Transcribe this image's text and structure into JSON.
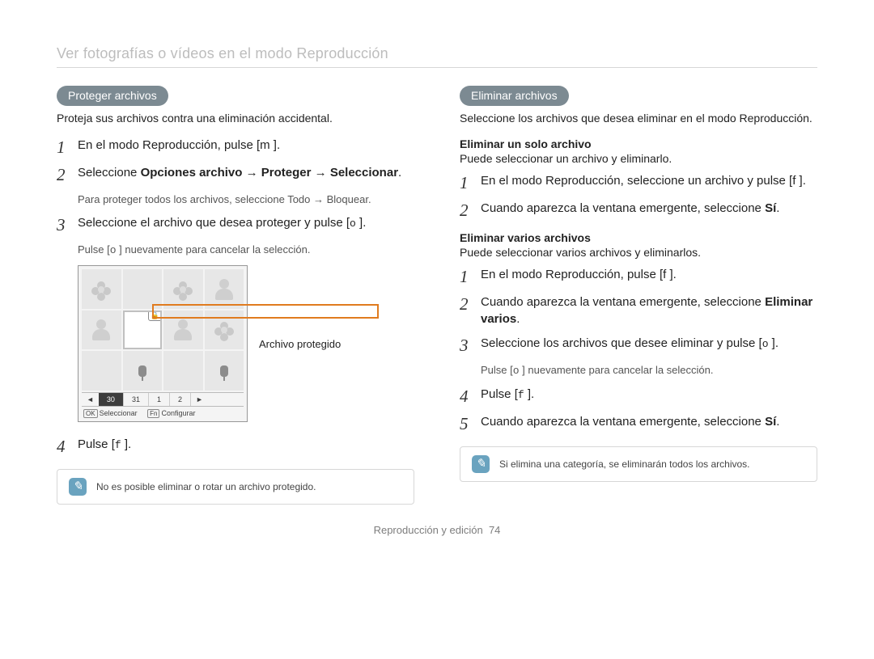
{
  "page_header": "Ver fotografías o vídeos en el modo Reproducción",
  "left": {
    "pill": "Proteger archivos",
    "intro": "Proteja sus archivos contra una eliminación accidental.",
    "step1": "En el modo Reproducción, pulse [m       ].",
    "step2_pre": "Seleccione ",
    "step2_b1": "Opciones archivo",
    "step2_arrow": " → ",
    "step2_b2": "Proteger",
    "step2_b3": "Seleccionar",
    "step2_post": ".",
    "step2_sub_pre": "Para proteger todos los archivos, seleccione ",
    "step2_sub_b1": "Todo",
    "step2_sub_b2": "Bloquear",
    "step3_pre": "Seleccione el archivo que desea proteger y pulse [",
    "step3_key": "o",
    "step3_post": "   ].",
    "step3_sub_pre": "Pulse [",
    "step3_sub_key": "o",
    "step3_sub_post": "    ] nuevamente para cancelar la selección.",
    "callout": "Archivo protegido",
    "step4_pre": "Pulse [",
    "step4_key": "f",
    "step4_post": "   ].",
    "note": "No es posible eliminar o rotar un archivo protegido."
  },
  "screen": {
    "lock_glyph": "🔒",
    "tabs": [
      "30",
      "31",
      "1",
      "2"
    ],
    "caret_l": "◄",
    "caret_r": "►",
    "btn_ok": "OK",
    "btn_ok_label": "Seleccionar",
    "btn_fn": "Fn",
    "btn_fn_label": "Configurar"
  },
  "right": {
    "pill": "Eliminar archivos",
    "intro": "Seleccione los archivos que desea eliminar en el modo Reproducción.",
    "sub1_head": "Eliminar un solo archivo",
    "sub1_text": "Puede seleccionar un archivo y eliminarlo.",
    "s1_step1": "En el modo Reproducción, seleccione un archivo y pulse [f    ].",
    "s1_step2_pre": "Cuando aparezca la ventana emergente, seleccione ",
    "s1_step2_b": "Sí",
    "sub2_head": "Eliminar varios archivos",
    "sub2_text": "Puede seleccionar varios archivos y eliminarlos.",
    "s2_step1": "En el modo Reproducción, pulse [f    ].",
    "s2_step2_pre": "Cuando aparezca la ventana emergente, seleccione ",
    "s2_step2_b": "Eliminar varios",
    "s2_step3_pre": "Seleccione los archivos que desee eliminar y pulse [",
    "s2_step3_key": "o",
    "s2_step3_post": "    ].",
    "s2_step3_sub_pre": "Pulse [",
    "s2_step3_sub_key": "o",
    "s2_step3_sub_post": "    ] nuevamente para cancelar la selección.",
    "s2_step4_pre": "Pulse [",
    "s2_step4_key": "f",
    "s2_step4_post": "   ].",
    "s2_step5_pre": "Cuando aparezca la ventana emergente, seleccione ",
    "s2_step5_b": "Sí",
    "note": "Si elimina una categoría, se eliminarán todos los archivos."
  },
  "footer": {
    "text": "Reproducción y edición",
    "page": "74"
  }
}
